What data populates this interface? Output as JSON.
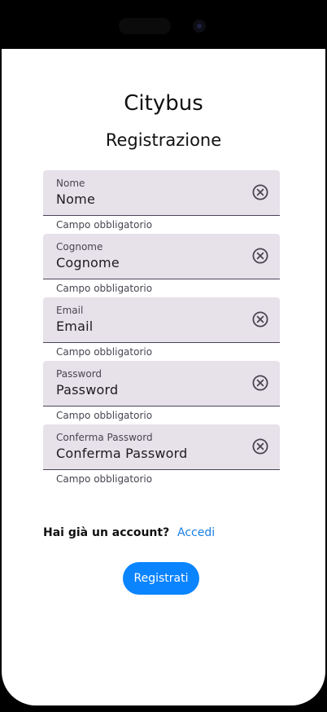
{
  "app": {
    "title": "Citybus",
    "page_title": "Registrazione"
  },
  "form": {
    "fields": [
      {
        "label": "Nome",
        "placeholder": "Nome",
        "helper": "Campo obbligatorio",
        "icon": "clear-circle-icon"
      },
      {
        "label": "Cognome",
        "placeholder": "Cognome",
        "helper": "Campo obbligatorio",
        "icon": "clear-circle-icon"
      },
      {
        "label": "Email",
        "placeholder": "Email",
        "helper": "Campo obbligatorio",
        "icon": "clear-circle-icon"
      },
      {
        "label": "Password",
        "placeholder": "Password",
        "helper": "Campo obbligatorio",
        "icon": "clear-circle-icon"
      },
      {
        "label": "Conferma Password",
        "placeholder": "Conferma Password",
        "helper": "Campo obbligatorio",
        "icon": "clear-circle-icon"
      }
    ]
  },
  "footer": {
    "account_question": "Hai già un account?",
    "login_link": "Accedi",
    "register_button": "Registrati"
  },
  "colors": {
    "accent": "#0a84ff",
    "link": "#1a7fe6",
    "field_bg": "#e7e1ea"
  }
}
